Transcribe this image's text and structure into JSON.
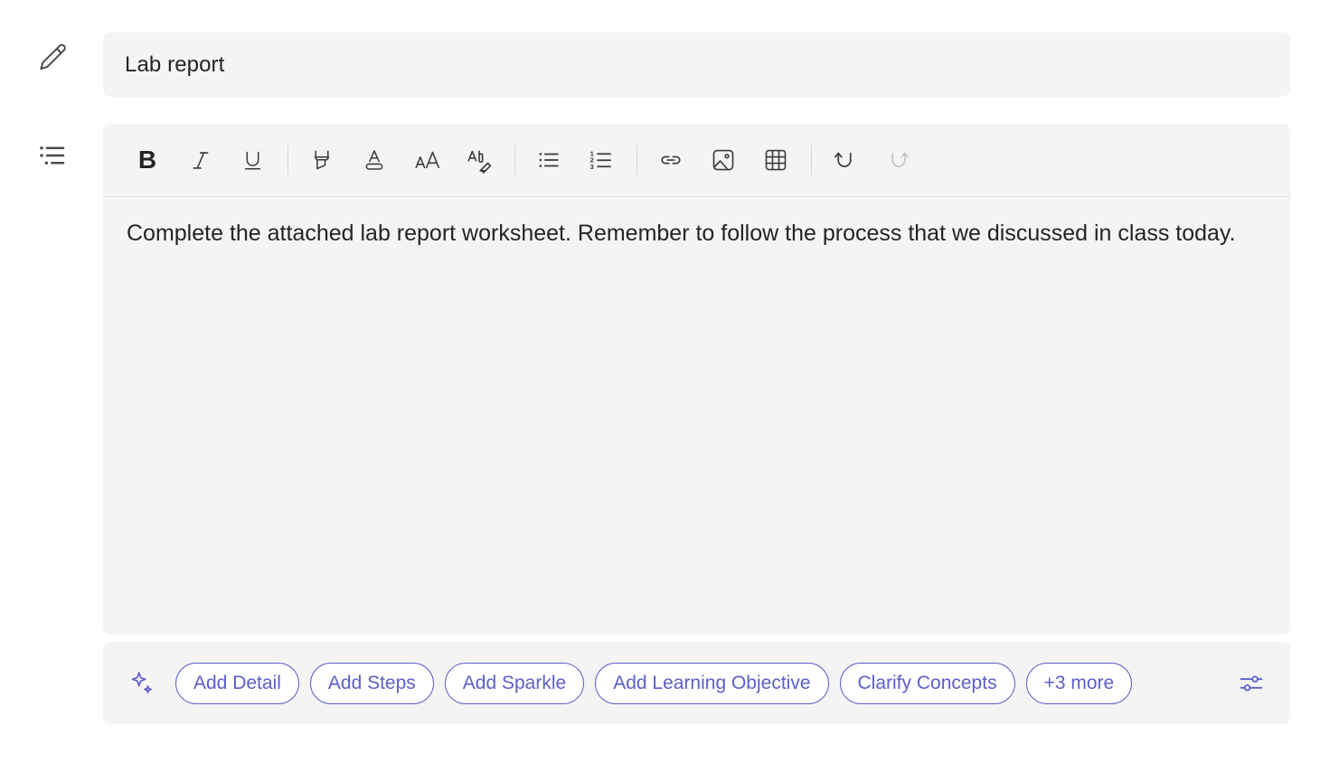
{
  "rail": {
    "items": [
      {
        "name": "edit-pencil",
        "icon": "pencil-icon",
        "tooltip": "Edit title"
      },
      {
        "name": "instructions-list",
        "icon": "bulleted-list-icon",
        "tooltip": "Instructions"
      }
    ]
  },
  "title_field": {
    "value": "Lab report",
    "placeholder": "Title"
  },
  "toolbar": {
    "groups": [
      [
        {
          "id": "bold",
          "label": "B",
          "icon": "bold-icon",
          "disabled": false
        },
        {
          "id": "italic",
          "label": "I",
          "icon": "italic-icon",
          "disabled": false
        },
        {
          "id": "underline",
          "label": "U",
          "icon": "underline-icon",
          "disabled": false
        }
      ],
      [
        {
          "id": "highlight",
          "label": "Highlight",
          "icon": "highlighter-icon",
          "disabled": false
        },
        {
          "id": "font-color",
          "label": "Font color",
          "icon": "font-color-icon",
          "disabled": false
        },
        {
          "id": "font-size",
          "label": "Font size",
          "icon": "font-size-icon",
          "disabled": false
        },
        {
          "id": "clear-formatting",
          "label": "Clear formatting",
          "icon": "clear-formatting-icon",
          "disabled": false
        }
      ],
      [
        {
          "id": "bulleted-list",
          "label": "Bulleted list",
          "icon": "bulleted-list-icon",
          "disabled": false
        },
        {
          "id": "numbered-list",
          "label": "Numbered list",
          "icon": "numbered-list-icon",
          "disabled": false
        }
      ],
      [
        {
          "id": "link",
          "label": "Insert link",
          "icon": "link-icon",
          "disabled": false
        },
        {
          "id": "image",
          "label": "Insert image",
          "icon": "image-icon",
          "disabled": false
        },
        {
          "id": "table",
          "label": "Insert table",
          "icon": "table-icon",
          "disabled": false
        }
      ],
      [
        {
          "id": "undo",
          "label": "Undo",
          "icon": "undo-icon",
          "disabled": false
        },
        {
          "id": "redo",
          "label": "Redo",
          "icon": "redo-icon",
          "disabled": true
        }
      ]
    ]
  },
  "body": {
    "value": "Complete the attached lab report worksheet. Remember to follow the process that we discussed in class today.",
    "placeholder": "Add instructions"
  },
  "suggestions": {
    "sparkle_icon": "sparkle-icon",
    "settings_icon": "sliders-settings-icon",
    "pills": [
      {
        "id": "add-detail",
        "label": "Add Detail"
      },
      {
        "id": "add-steps",
        "label": "Add Steps"
      },
      {
        "id": "add-sparkle",
        "label": "Add Sparkle"
      },
      {
        "id": "add-learning-objective",
        "label": "Add Learning Objective"
      },
      {
        "id": "clarify-concepts",
        "label": "Clarify Concepts"
      },
      {
        "id": "more",
        "label": "+3 more"
      }
    ]
  },
  "colors": {
    "accent": "#5b5fc7",
    "panel_bg": "#f4f4f4",
    "page_bg": "#ffffff",
    "text": "#242424",
    "icon": "#3b3a39",
    "icon_disabled": "#c8c6c4",
    "divider": "#e1e1e3"
  }
}
